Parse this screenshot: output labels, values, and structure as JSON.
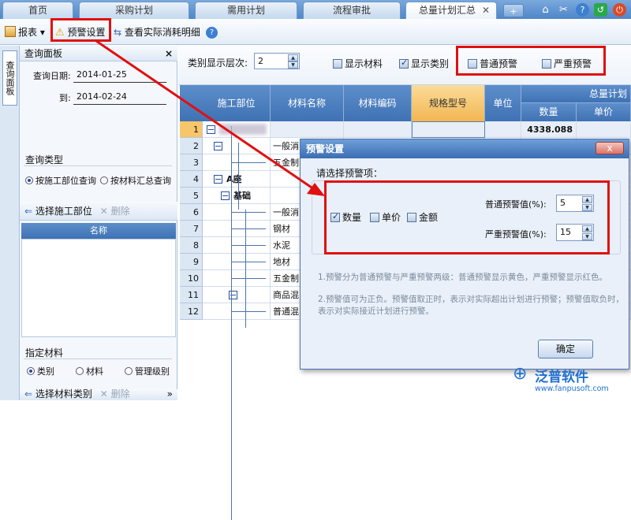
{
  "tabs": [
    {
      "label": "首页"
    },
    {
      "label": "采购计划"
    },
    {
      "label": "需用计划"
    },
    {
      "label": "流程审批"
    },
    {
      "label": "总量计划汇总"
    }
  ],
  "toolbar": {
    "report_label": "报表",
    "alert_setting_label": "预警设置",
    "view_consumption_label": "查看实际消耗明细",
    "help_label": "?"
  },
  "side_tab_label": "查询面板",
  "query_panel": {
    "title": "查询面板",
    "date_label": "查询日期:",
    "date_from": "2014-01-25",
    "to_label": "到:",
    "date_to": "2014-02-24",
    "query_type_title": "查询类型",
    "query_by_dept": "按施工部位查询",
    "query_by_material": "按材料汇总查询",
    "select_dept_label": "选择施工部位",
    "delete_label": "删除",
    "name_column": "名称",
    "specified_material_title": "指定材料",
    "opt_category": "类别",
    "opt_material": "材料",
    "opt_level": "管理级别",
    "select_material_category": "选择材料类别",
    "delete_label2": "删除"
  },
  "options": {
    "level_label": "类别显示层次:",
    "level_value": "2",
    "show_material": "显示材料",
    "show_category": "显示类别",
    "normal_alert": "普通预警",
    "severe_alert": "严重预警"
  },
  "grid": {
    "headers": [
      "施工部位",
      "材料名称",
      "材料编码",
      "规格型号",
      "单位",
      "总量计划",
      "数量",
      "单价"
    ],
    "rows": [
      {
        "n": "1",
        "dept": "",
        "mat": "",
        "qty": "4338.088"
      },
      {
        "n": "2",
        "dept": "",
        "mat": "一般消",
        "qty": ""
      },
      {
        "n": "3",
        "dept": "",
        "mat": "五金制",
        "qty": ""
      },
      {
        "n": "4",
        "dept": "A座",
        "mat": "",
        "qty": ""
      },
      {
        "n": "5",
        "dept": "基础",
        "mat": "",
        "qty": ""
      },
      {
        "n": "6",
        "dept": "",
        "mat": "一般消",
        "qty": ""
      },
      {
        "n": "7",
        "dept": "",
        "mat": "钢材",
        "qty": ""
      },
      {
        "n": "8",
        "dept": "",
        "mat": "水泥",
        "qty": ""
      },
      {
        "n": "9",
        "dept": "",
        "mat": "地材",
        "qty": ""
      },
      {
        "n": "10",
        "dept": "",
        "mat": "五金制",
        "qty": ""
      },
      {
        "n": "11",
        "dept": "",
        "mat": "商品混",
        "qty": ""
      },
      {
        "n": "12",
        "dept": "",
        "mat": "普通混",
        "qty": ""
      }
    ]
  },
  "dialog": {
    "title": "预警设置",
    "close_label": "x",
    "prompt": "请选择预警项：",
    "opt_qty": "数量",
    "opt_price": "单价",
    "opt_amount": "金额",
    "normal_label": "普通预警值(%):",
    "normal_value": "5",
    "severe_label": "严重预警值(%):",
    "severe_value": "15",
    "note1": "1.预警分为普通预警与严重预警两级：普通预警显示黄色，严重预警显示红色。",
    "note2": "2.预警值可为正负。预警值取正时，表示对实际超出计划进行预警；预警值取负时，表示对实际接近计划进行预警。",
    "ok_label": "确定"
  },
  "watermark": {
    "brand": "泛普软件",
    "url": "www.fanpusoft.com"
  },
  "colors": {
    "highlight": "#e01010",
    "header_blue": "#3f72b4",
    "spec_header": "#f7c56a"
  }
}
